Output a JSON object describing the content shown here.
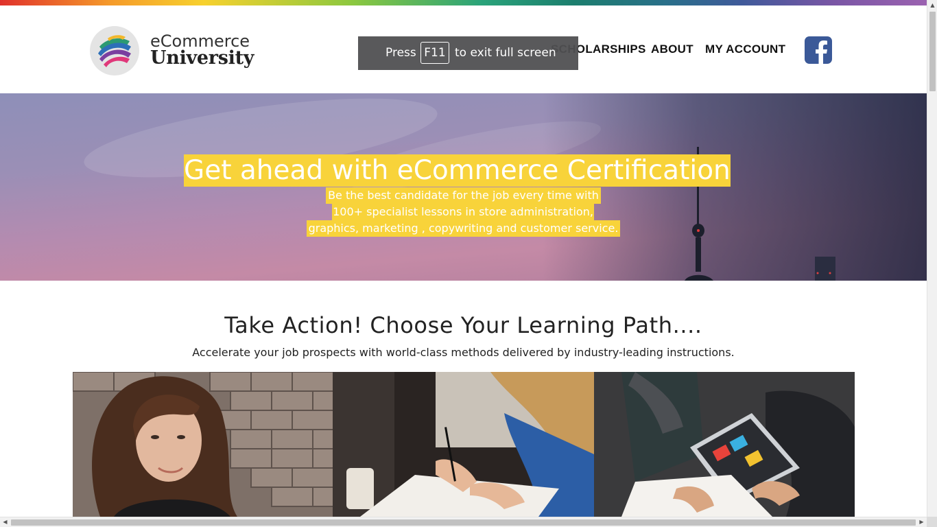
{
  "brand": {
    "line1": "eCommerce",
    "line2": "University"
  },
  "nav": {
    "scholarships": "SCHOLARSHIPS",
    "about": "ABOUT",
    "my_account": "MY ACCOUNT"
  },
  "fullscreen_toast": {
    "press": "Press",
    "key": "F11",
    "rest": "to exit full screen"
  },
  "hero": {
    "title": "Get ahead with eCommerce Certification",
    "lines": [
      "Be the best candidate for the job every time with",
      "100+ specialist lessons in store administration,",
      "graphics, marketing , copywriting and customer service."
    ]
  },
  "learning": {
    "title": "Take Action! Choose Your Learning Path....",
    "subtitle": "Accelerate your job prospects with world-class methods delivered by industry-leading instructions."
  },
  "icons": {
    "logo": "ribbon-logo-icon",
    "facebook": "facebook-icon"
  },
  "colors": {
    "highlight": "#f8d33a",
    "facebook": "#3b5998",
    "text": "#222222"
  }
}
